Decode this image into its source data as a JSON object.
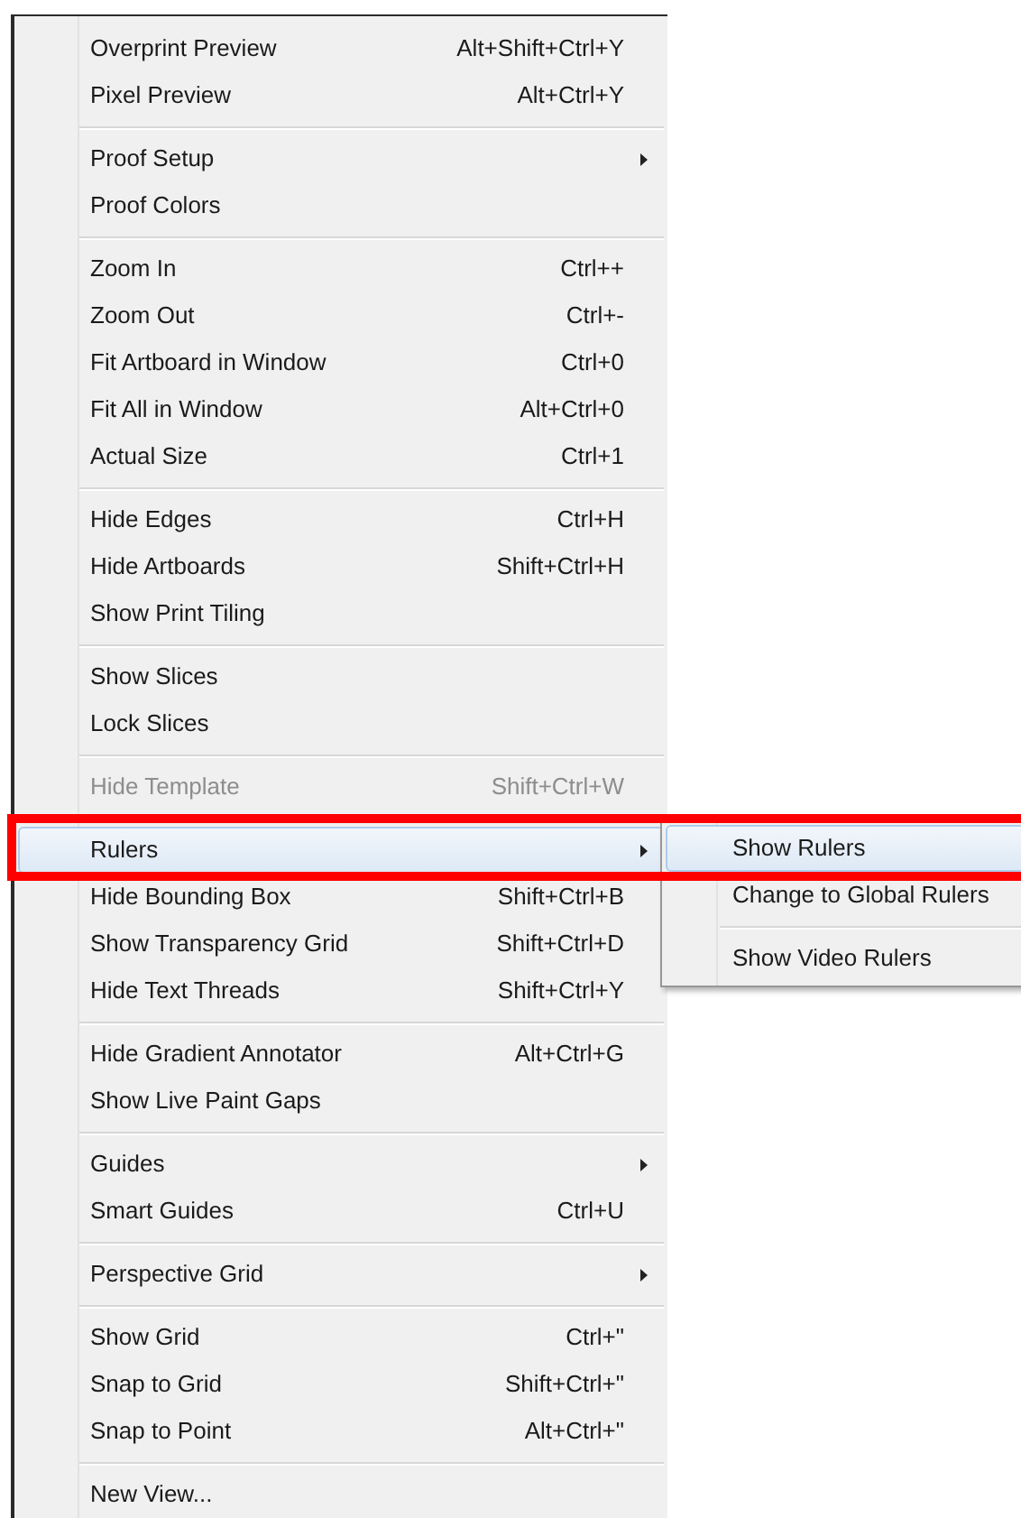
{
  "menu": {
    "groups": [
      {
        "items": [
          {
            "label": "Overprint Preview",
            "shortcut": "Alt+Shift+Ctrl+Y",
            "submenu": false,
            "disabled": false,
            "selected": false
          },
          {
            "label": "Pixel Preview",
            "shortcut": "Alt+Ctrl+Y",
            "submenu": false,
            "disabled": false,
            "selected": false
          }
        ]
      },
      {
        "items": [
          {
            "label": "Proof Setup",
            "submenu": true,
            "disabled": false,
            "selected": false
          },
          {
            "label": "Proof Colors",
            "submenu": false,
            "disabled": false,
            "selected": false
          }
        ]
      },
      {
        "items": [
          {
            "label": "Zoom In",
            "shortcut": "Ctrl++",
            "submenu": false,
            "disabled": false,
            "selected": false
          },
          {
            "label": "Zoom Out",
            "shortcut": "Ctrl+-",
            "submenu": false,
            "disabled": false,
            "selected": false
          },
          {
            "label": "Fit Artboard in Window",
            "shortcut": "Ctrl+0",
            "submenu": false,
            "disabled": false,
            "selected": false
          },
          {
            "label": "Fit All in Window",
            "shortcut": "Alt+Ctrl+0",
            "submenu": false,
            "disabled": false,
            "selected": false
          },
          {
            "label": "Actual Size",
            "shortcut": "Ctrl+1",
            "submenu": false,
            "disabled": false,
            "selected": false
          }
        ]
      },
      {
        "items": [
          {
            "label": "Hide Edges",
            "shortcut": "Ctrl+H",
            "submenu": false,
            "disabled": false,
            "selected": false
          },
          {
            "label": "Hide Artboards",
            "shortcut": "Shift+Ctrl+H",
            "submenu": false,
            "disabled": false,
            "selected": false
          },
          {
            "label": "Show Print Tiling",
            "submenu": false,
            "disabled": false,
            "selected": false
          }
        ]
      },
      {
        "items": [
          {
            "label": "Show Slices",
            "submenu": false,
            "disabled": false,
            "selected": false
          },
          {
            "label": "Lock Slices",
            "submenu": false,
            "disabled": false,
            "selected": false
          }
        ]
      },
      {
        "items": [
          {
            "label": "Hide Template",
            "shortcut": "Shift+Ctrl+W",
            "submenu": false,
            "disabled": true,
            "selected": false
          }
        ]
      },
      {
        "items": [
          {
            "label": "Rulers",
            "submenu": true,
            "disabled": false,
            "selected": true
          },
          {
            "label": "Hide Bounding Box",
            "shortcut": "Shift+Ctrl+B",
            "submenu": false,
            "disabled": false,
            "selected": false
          },
          {
            "label": "Show Transparency Grid",
            "shortcut": "Shift+Ctrl+D",
            "submenu": false,
            "disabled": false,
            "selected": false
          },
          {
            "label": "Hide Text Threads",
            "shortcut": "Shift+Ctrl+Y",
            "submenu": false,
            "disabled": false,
            "selected": false
          }
        ]
      },
      {
        "items": [
          {
            "label": "Hide Gradient Annotator",
            "shortcut": "Alt+Ctrl+G",
            "submenu": false,
            "disabled": false,
            "selected": false
          },
          {
            "label": "Show Live Paint Gaps",
            "submenu": false,
            "disabled": false,
            "selected": false
          }
        ]
      },
      {
        "items": [
          {
            "label": "Guides",
            "submenu": true,
            "disabled": false,
            "selected": false
          },
          {
            "label": "Smart Guides",
            "shortcut": "Ctrl+U",
            "submenu": false,
            "disabled": false,
            "selected": false
          }
        ]
      },
      {
        "items": [
          {
            "label": "Perspective Grid",
            "submenu": true,
            "disabled": false,
            "selected": false
          }
        ]
      },
      {
        "items": [
          {
            "label": "Show Grid",
            "shortcut": "Ctrl+\"",
            "submenu": false,
            "disabled": false,
            "selected": false
          },
          {
            "label": "Snap to Grid",
            "shortcut": "Shift+Ctrl+\"",
            "submenu": false,
            "disabled": false,
            "selected": false
          },
          {
            "label": "Snap to Point",
            "shortcut": "Alt+Ctrl+\"",
            "submenu": false,
            "disabled": false,
            "selected": false
          }
        ]
      },
      {
        "items": [
          {
            "label": "New View...",
            "submenu": false,
            "disabled": false,
            "selected": false
          }
        ]
      }
    ]
  },
  "submenu": {
    "groups": [
      {
        "items": [
          {
            "label": "Show Rulers",
            "selected": true
          },
          {
            "label": "Change to Global Rulers",
            "selected": false
          }
        ]
      },
      {
        "items": [
          {
            "label": "Show Video Rulers",
            "selected": false
          }
        ]
      }
    ]
  }
}
